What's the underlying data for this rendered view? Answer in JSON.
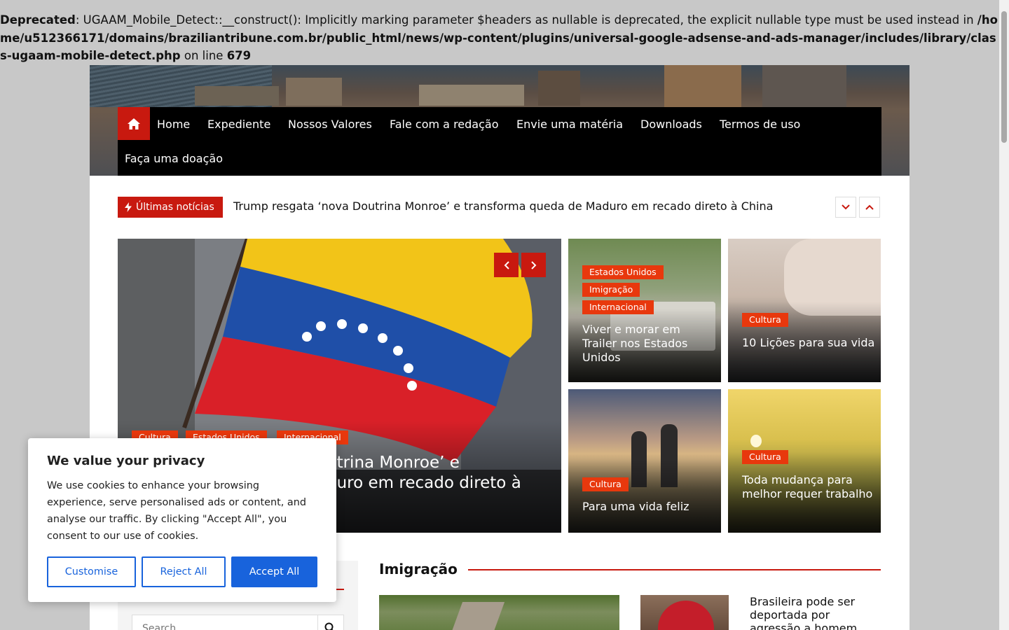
{
  "warning": {
    "label": "Deprecated",
    "message": ": UGAAM_Mobile_Detect::__construct(): Implicitly marking parameter $headers as nullable is deprecated, the explicit nullable type must be used instead in ",
    "path": "/home/u512366171/domains/braziliantribune.com.br/public_html/news/wp-content/plugins/universal-google-adsense-and-ads-manager/includes/library/class-ugaam-mobile-detect.php",
    "on_line": " on line ",
    "line": "679"
  },
  "nav": {
    "home_icon": "home-icon",
    "items": [
      "Home",
      "Expediente",
      "Nossos Valores",
      "Fale com a redação",
      "Envie uma matéria",
      "Downloads",
      "Termos de uso",
      "Faça uma doação"
    ]
  },
  "ticker": {
    "label": "Últimas notícias",
    "icon": "lightning-icon",
    "headline": "Trump resgata ‘nova Doutrina Monroe’ e transforma queda de Maduro em recado direto à China"
  },
  "slider": {
    "tags": [
      "Cultura",
      "Estados Unidos",
      "Internacional"
    ],
    "title_line1": "utrina Monroe’ e",
    "title_line2": "duro em recado direto à"
  },
  "cards": [
    {
      "tags": [
        "Estados Unidos",
        "Imigração",
        "Internacional"
      ],
      "title": "Viver e morar em Trailer nos Estados Unidos"
    },
    {
      "tags": [
        "Cultura"
      ],
      "title": "10 Lições para sua vida"
    },
    {
      "tags": [
        "Cultura"
      ],
      "title": "Para uma vida feliz"
    },
    {
      "tags": [
        "Cultura"
      ],
      "title": "Toda mudança para melhor requer trabalho"
    }
  ],
  "cookie": {
    "title": "We value your privacy",
    "body": "We use cookies to enhance your browsing experience, serve personalised ads or content, and analyse our traffic. By clicking \"Accept All\", you consent to our use of cookies.",
    "customise": "Customise",
    "reject": "Reject All",
    "accept": "Accept All"
  },
  "sidebar": {
    "search_placeholder": "Search"
  },
  "section": {
    "title": "Imigração",
    "post2_title": "Brasileira pode ser deportada por agressão a homem"
  },
  "colors": {
    "brand_red": "#c8190f",
    "tag_orange": "#e8380d",
    "cookie_blue": "#1863dc"
  }
}
